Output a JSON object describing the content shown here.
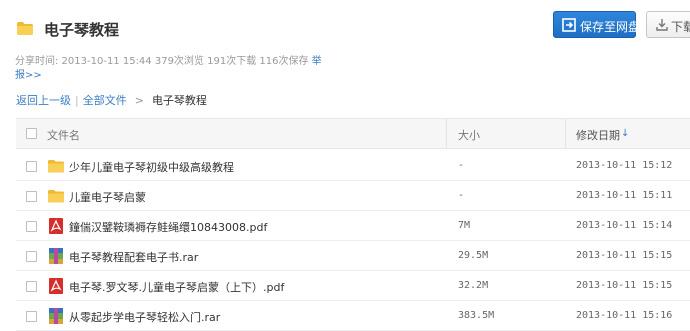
{
  "header": {
    "title": "电子琴教程",
    "save_label": "保存至网盘",
    "download_label": "下载"
  },
  "meta": {
    "text": "分享时间: 2013-10-11 15:44 379次浏览 191次下载 116次保存",
    "report_a": "举",
    "report_b": "报>>"
  },
  "breadcrumb": {
    "back": "返回上一级",
    "all": "全部文件",
    "current": "电子琴教程"
  },
  "table": {
    "col_name": "文件名",
    "col_size": "大小",
    "col_date": "修改日期",
    "sort_icon": "↓",
    "rows": [
      {
        "name": "少年儿童电子琴初级中级高级教程",
        "size": "-",
        "date": "2013-10-11 15:12",
        "icon": "folder-icon"
      },
      {
        "name": "儿童电子琴启蒙",
        "size": "-",
        "date": "2013-10-11 15:11",
        "icon": "folder-icon"
      },
      {
        "name": "鐘偳汉鐾鞍璘褥存鲑绳缳10843008.pdf",
        "size": "7M",
        "date": "2013-10-11 15:14",
        "icon": "pdf-icon"
      },
      {
        "name": "电子琴教程配套电子书.rar",
        "size": "29.5M",
        "date": "2013-10-11 15:15",
        "icon": "rar-icon"
      },
      {
        "name": "电子琴.罗文琴.儿童电子琴启蒙（上下）.pdf",
        "size": "32.2M",
        "date": "2013-10-11 15:15",
        "icon": "pdf-icon"
      },
      {
        "name": "从零起步学电子琴轻松入门.rar",
        "size": "383.5M",
        "date": "2013-10-11 15:16",
        "icon": "rar-icon"
      }
    ]
  },
  "colors": {
    "accent": "#2f86db",
    "link": "#3b7ec5",
    "folder": "#f5c642",
    "pdf": "#d62d2d"
  }
}
